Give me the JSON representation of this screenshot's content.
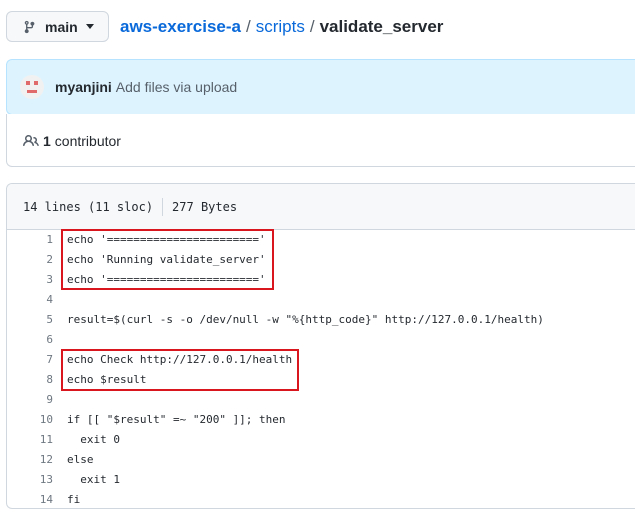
{
  "branch": {
    "label": "main",
    "icon": "git-branch-icon"
  },
  "breadcrumb": {
    "repo": "aws-exercise-a",
    "sep1": "/",
    "folder": "scripts",
    "sep2": "/",
    "file": "validate_server"
  },
  "commit": {
    "author": "myanjini",
    "message": "Add files via upload",
    "avatar_color": "#e06a6a"
  },
  "contributors": {
    "count": "1",
    "label": "contributor",
    "icon": "people-icon"
  },
  "file_info": {
    "lines": "14 lines (11 sloc)",
    "size": "277 Bytes"
  },
  "code_lines": [
    {
      "n": "1",
      "text": "echo '======================='"
    },
    {
      "n": "2",
      "text": "echo 'Running validate_server'"
    },
    {
      "n": "3",
      "text": "echo '======================='"
    },
    {
      "n": "4",
      "text": ""
    },
    {
      "n": "5",
      "text": "result=$(curl -s -o /dev/null -w \"%{http_code}\" http://127.0.0.1/health)"
    },
    {
      "n": "6",
      "text": ""
    },
    {
      "n": "7",
      "text": "echo Check http://127.0.0.1/health"
    },
    {
      "n": "8",
      "text": "echo $result"
    },
    {
      "n": "9",
      "text": ""
    },
    {
      "n": "10",
      "text": "if [[ \"$result\" =~ \"200\" ]]; then"
    },
    {
      "n": "11",
      "text": "  exit 0"
    },
    {
      "n": "12",
      "text": "else"
    },
    {
      "n": "13",
      "text": "  exit 1"
    },
    {
      "n": "14",
      "text": "fi"
    }
  ],
  "colors": {
    "link": "#0969da",
    "highlight_box": "#d9161d",
    "commit_bg": "#ddf4ff"
  }
}
